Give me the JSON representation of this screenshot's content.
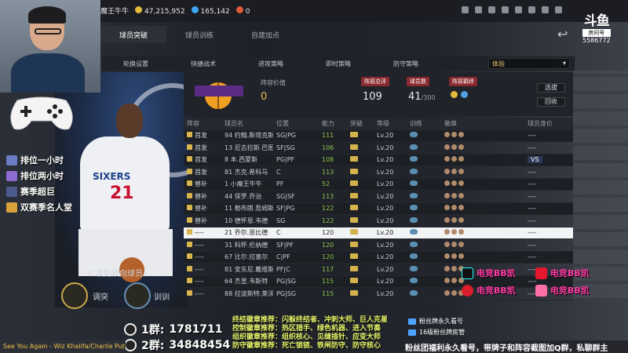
{
  "topbar": {
    "streamer_name": "魔王牛牛",
    "stats": [
      "47,215,952",
      "165,142",
      "0"
    ],
    "icons": [
      "bell-icon",
      "user-icon",
      "mail-icon",
      "settings-icon",
      "video-icon",
      "phone-icon",
      "refresh-icon",
      "power-icon"
    ]
  },
  "logo": {
    "brand": "斗鱼",
    "sub": "房间号",
    "room": "5586772"
  },
  "overlay": {
    "items": [
      {
        "label": "排位一小时"
      },
      {
        "label": "排位两小时"
      },
      {
        "label": "赛季超巨"
      },
      {
        "label": "双赛季名人堂"
      }
    ]
  },
  "tabs": [
    {
      "label": "球员突破",
      "active": true
    },
    {
      "label": "球员训练",
      "active": false
    },
    {
      "label": "自建加点",
      "active": false
    }
  ],
  "subtabs": [
    "轮换设置",
    "快捷战术",
    "进攻策略",
    "即时策略",
    "防守策略"
  ],
  "dropdown": {
    "value": "体验"
  },
  "player": {
    "role": "C 攻防双向球员",
    "jersey_text": "SIXERS",
    "jersey_number": "21",
    "left_button": "调突",
    "right_button": "训训"
  },
  "summary": {
    "team_value_label": "阵容价值",
    "team_value": "0",
    "total_label": "阵容总评",
    "total": "109",
    "count_label": "球员数",
    "count": "41",
    "count_max": "/300",
    "strength_label": "阵容羁绊",
    "select_btn": "选拔",
    "recycle_btn": "回收"
  },
  "table": {
    "headers": [
      "阵容",
      "球员名",
      "位置",
      "能力",
      "突破",
      "等级",
      "训练",
      "徽章",
      "球员身价"
    ],
    "rows": [
      {
        "lineup": "首发",
        "num": "94",
        "name": "约翰.斯塔克斯",
        "pos": "SG|PG",
        "ovr": "111",
        "level": "Lv.20",
        "price": "----"
      },
      {
        "lineup": "首发",
        "num": "13",
        "name": "尼古拉斯.巴图姆",
        "pos": "SF|SG",
        "ovr": "106",
        "level": "Lv.20",
        "price": "----"
      },
      {
        "lineup": "首发",
        "num": "8",
        "name": "本.西蒙斯",
        "pos": "PG|PF",
        "ovr": "108",
        "level": "Lv.20",
        "price": "VS"
      },
      {
        "lineup": "首发",
        "num": "81",
        "name": "杰克.希科马",
        "pos": "C",
        "ovr": "113",
        "level": "Lv.20",
        "price": "----"
      },
      {
        "lineup": "替补",
        "num": "1",
        "name": "小魔王牛牛",
        "pos": "PF",
        "ovr": "52",
        "level": "Lv.20",
        "price": "----"
      },
      {
        "lineup": "替补",
        "num": "44",
        "name": "保罗.乔治",
        "pos": "SG|SF",
        "ovr": "113",
        "level": "Lv.20",
        "price": "----"
      },
      {
        "lineup": "替补",
        "num": "11",
        "name": "勒布朗.詹姆斯",
        "pos": "SF|PG",
        "ovr": "122",
        "level": "Lv.20",
        "price": "----"
      },
      {
        "lineup": "替补",
        "num": "10",
        "name": "德怀恩.韦德",
        "pos": "SG",
        "ovr": "122",
        "level": "Lv.20",
        "price": "----"
      },
      {
        "lineup": "----",
        "num": "21",
        "name": "乔尔.恩比德",
        "pos": "C",
        "ovr": "120",
        "level": "Lv.20",
        "price": "----"
      },
      {
        "lineup": "----",
        "num": "31",
        "name": "科怀.伦纳德",
        "pos": "SF|PF",
        "ovr": "120",
        "level": "Lv.20",
        "price": "----"
      },
      {
        "lineup": "----",
        "num": "67",
        "name": "比尔.拉塞尔",
        "pos": "C|PF",
        "ovr": "120",
        "level": "Lv.20",
        "price": "----"
      },
      {
        "lineup": "----",
        "num": "81",
        "name": "安东尼.戴维斯",
        "pos": "PF|C",
        "ovr": "117",
        "level": "Lv.20",
        "price": "----"
      },
      {
        "lineup": "----",
        "num": "64",
        "name": "杰里.韦斯特",
        "pos": "PG|SG",
        "ovr": "115",
        "level": "Lv.20",
        "price": "----"
      },
      {
        "lineup": "----",
        "num": "88",
        "name": "拉波斯特.莱沃",
        "pos": "PG|SG",
        "ovr": "115",
        "level": "Lv.20",
        "price": "----"
      }
    ]
  },
  "social": [
    {
      "platform": "douyin",
      "handle": "电竞BB凯"
    },
    {
      "platform": "weibo",
      "handle": "电竞BB凯"
    },
    {
      "platform": "netease",
      "handle": "电竞BB凯"
    },
    {
      "platform": "xiaohongshu",
      "handle": "电竞BB凯"
    }
  ],
  "qq_groups": [
    {
      "label": "1群:",
      "number": "1781711"
    },
    {
      "label": "2群:",
      "number": "34848454"
    }
  ],
  "promo_lines": [
    "终结徽章推荐：闪躲终结者、冲刺大师、巨人克星",
    "控制徽章推荐：热区猎手、绿色机器、进入节奏",
    "组织徽章推荐：组织核心、见缝插针、应变大师",
    "防守徽章推荐：死亡锁链、铁闸防守、防守核心"
  ],
  "fan_titles": [
    "粉丝牌永久看号",
    "16级粉丝牌房管"
  ],
  "music": "See You Again - Wiz Khalifa/Charlie Puth",
  "marquee": "粉丝团福利永久看号，带牌子和阵容截图加Q群，私聊群主"
}
